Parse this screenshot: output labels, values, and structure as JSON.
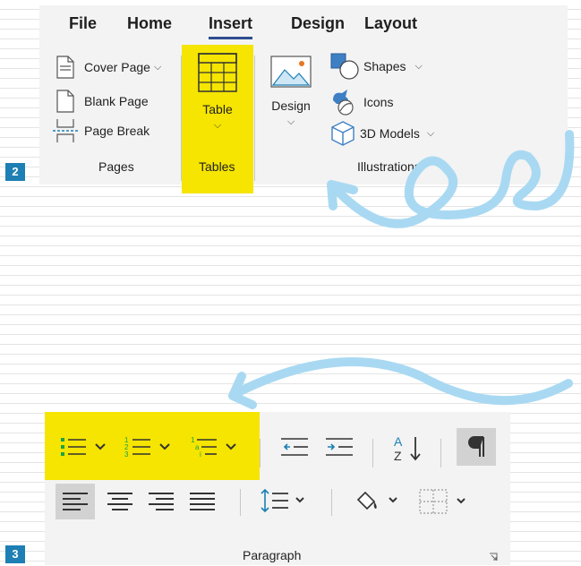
{
  "badges": {
    "step2": "2",
    "step3": "3"
  },
  "menu": {
    "items": [
      {
        "label": "File"
      },
      {
        "label": "Home"
      },
      {
        "label": "Insert"
      },
      {
        "label": "Design"
      },
      {
        "label": "Layout"
      }
    ],
    "active": "Insert"
  },
  "pages_group": {
    "cover_page": "Cover Page",
    "blank_page": "Blank Page",
    "page_break": "Page Break",
    "label": "Pages"
  },
  "tables_group": {
    "table": "Table",
    "label": "Tables"
  },
  "illustrations_group": {
    "design": "Design",
    "shapes": "Shapes",
    "icons": "Icons",
    "models_3d": "3D Models",
    "label": "Illustrations"
  },
  "paragraph_group": {
    "label": "Paragraph"
  },
  "colors": {
    "highlight": "#f5e500",
    "arrow": "#a9d9f2",
    "badge": "#1d7fb4",
    "list_icon": "#1aa34a",
    "active_tab_underline": "#2e4d8f"
  },
  "icons": {
    "ribbon": [
      "cover-page-icon",
      "blank-page-icon",
      "page-break-icon",
      "table-icon",
      "design-icon",
      "shapes-icon",
      "icons-icon",
      "3d-models-icon"
    ],
    "paragraph": [
      "bullets-icon",
      "numbering-icon",
      "multilevel-list-icon",
      "decrease-indent-icon",
      "increase-indent-icon",
      "sort-icon",
      "show-formatting-icon",
      "align-left-icon",
      "center-icon",
      "align-right-icon",
      "justify-icon",
      "line-spacing-icon",
      "shading-icon",
      "borders-icon",
      "dialog-launcher-icon"
    ]
  }
}
